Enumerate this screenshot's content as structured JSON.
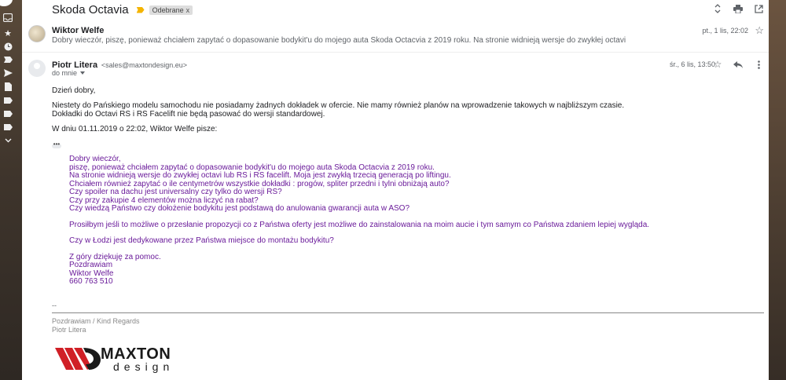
{
  "thread": {
    "subject": "Skoda Octavia",
    "label": "Odebrane",
    "label_remove": "x"
  },
  "message1": {
    "sender": "Wiktor Welfe",
    "snippet": "Dobry wieczór, piszę, ponieważ chciałem zapytać o dopasowanie bodykit'u do mojego auta Skoda Octacvia z 2019 roku. Na stronie widnieją wersje do zwykłej octavi",
    "date": "pt., 1 lis, 22:02"
  },
  "message2": {
    "sender": "Piotr Litera",
    "email": "<sales@maxtondesign.eu>",
    "to": "do mnie",
    "date": "śr., 6 lis, 13:50",
    "greeting": "Dzień dobry,",
    "paragraph1": "Niestety do Pańskiego modelu samochodu nie posiadamy żadnych dokładek w ofercie. Nie mamy również planów na wprowadzenie takowych w najbliższym czasie.",
    "paragraph2": "Dokładki do Octavi RS i RS Facelift nie będą pasować do wersji standardowej.",
    "quote_intro": "W dniu 01.11.2019 o 22:02, Wiktor Welfe pisze:",
    "ellipsis": "•••",
    "quoted": {
      "line1": "Dobry wieczór,",
      "line2": "piszę, ponieważ chciałem zapytać o dopasowanie bodykit'u do mojego auta Skoda Octacvia z 2019 roku.",
      "line3": "Na stronie widnieją wersje do zwykłej octavi lub RS i RS facelift. Moja jest zwykłą trzecią generacją po liftingu.",
      "line4": "Chciałem również zapytać o ile centymetrów wszystkie dokładki : progów, spliter przedni i tylni obniżają auto?",
      "line5": "Czy spoiler na dachu jest universalny czy tylko do wersji RS?",
      "line6": "Czy przy zakupie 4 elementów można liczyć na rabat?",
      "line7": "Czy wiedzą Państwo czy dołożenie bodykitu jest podstawą do anulowania gwarancji auta w ASO?",
      "line8": "Prosiłbym jeśli to możliwe o przesłanie propozycji co z Państwa oferty jest możliwe do zainstalowania na moim aucie i tym samym co Państwa zdaniem lepiej wygląda.",
      "line9": "Czy w Łodzi jest dedykowane przez Państwa miejsce do montażu bodykitu?",
      "line10": "Z góry dziękuję za pomoc.",
      "line11": "Pozdrawiam",
      "line12": "Wiktor Welfe",
      "line13": "660 763 510"
    },
    "sig_dash": "--",
    "sig_regards": "Pozdrawiam / Kind Regards",
    "sig_name": "Piotr Litera",
    "logo_main": "MAXTON",
    "logo_sub": "design"
  },
  "colors": {
    "quote_text": "#6a1b9a",
    "important_marker": "#f4b400",
    "logo_red": "#d01f26"
  }
}
